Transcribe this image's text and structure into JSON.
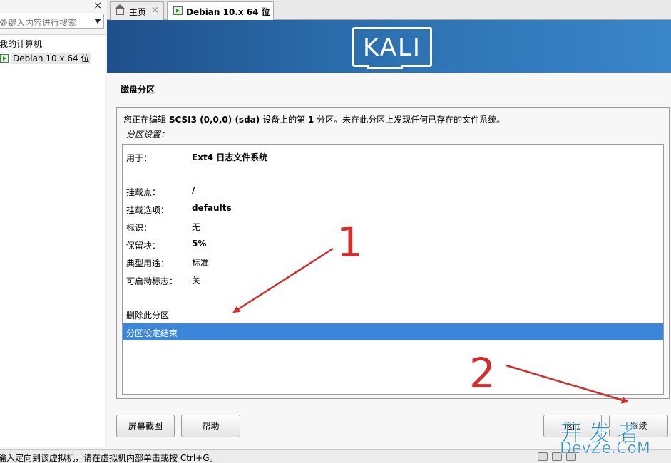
{
  "library": {
    "search_placeholder": "此处键入内容进行搜索",
    "root_label": "我的计算机",
    "vm_label": "Debian 10.x 64 位",
    "close_glyph": "×"
  },
  "tabs": [
    {
      "label": "主页"
    },
    {
      "label": "Debian 10.x 64 位"
    }
  ],
  "tab_close_glyph": "×",
  "banner": {
    "logo_text": "KALI"
  },
  "installer": {
    "step_title": "磁盘分区",
    "desc_pre": "您正在编辑 ",
    "desc_device": "SCSI3 (0,0,0) (sda)",
    "desc_mid": " 设备上的第 ",
    "desc_num": "1",
    "desc_post": " 分区。未在此分区上发现任何已存在的文件系统。",
    "settings_label": "分区设置：",
    "rows": [
      {
        "key": "用于：",
        "value": "Ext4 日志文件系统"
      },
      {
        "key": "挂载点：",
        "value": "/"
      },
      {
        "key": "挂载选项：",
        "value": "defaults"
      },
      {
        "key": "标识：",
        "value": "无"
      },
      {
        "key": "保留块：",
        "value": "5%"
      },
      {
        "key": "典型用途：",
        "value": "标准"
      },
      {
        "key": "可启动标志：",
        "value": "关"
      }
    ],
    "actions": [
      {
        "label": "删除此分区"
      },
      {
        "label": "分区设定结束",
        "selected": true
      }
    ],
    "buttons": {
      "screenshot": "屏幕截图",
      "help": "帮助",
      "back": "返回",
      "next": "继续"
    }
  },
  "annotations": {
    "one": "1",
    "two": "2",
    "color": "#d42b2b"
  },
  "watermark": {
    "line1": "开发者",
    "line2": "DevZe.CoM"
  },
  "status": {
    "text": "要将输入定向到该虚拟机，请在虚拟机内部单击或按 Ctrl+G。"
  },
  "colors": {
    "selection": "#3d85d8",
    "banner": "#2b6fae"
  }
}
